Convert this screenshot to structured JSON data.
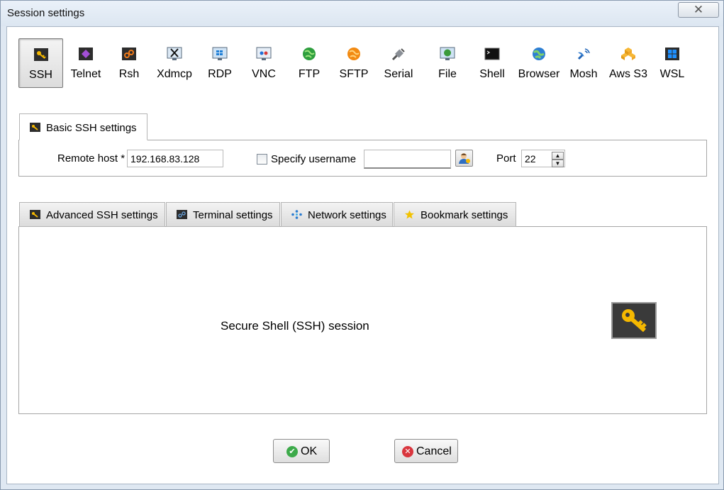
{
  "window": {
    "title": "Session settings",
    "close_glyph": "✕"
  },
  "session_types": [
    {
      "label": "SSH",
      "icon": "ssh-key-icon",
      "active": true
    },
    {
      "label": "Telnet",
      "icon": "telnet-icon"
    },
    {
      "label": "Rsh",
      "icon": "rsh-icon"
    },
    {
      "label": "Xdmcp",
      "icon": "xdmcp-icon"
    },
    {
      "label": "RDP",
      "icon": "rdp-monitor-icon"
    },
    {
      "label": "VNC",
      "icon": "vnc-monitor-icon"
    },
    {
      "label": "FTP",
      "icon": "ftp-globe-icon"
    },
    {
      "label": "SFTP",
      "icon": "sftp-globe-icon"
    },
    {
      "label": "Serial",
      "icon": "serial-plug-icon"
    },
    {
      "label": "File",
      "icon": "file-monitor-icon"
    },
    {
      "label": "Shell",
      "icon": "shell-terminal-icon"
    },
    {
      "label": "Browser",
      "icon": "browser-globe-icon"
    },
    {
      "label": "Mosh",
      "icon": "mosh-satellite-icon"
    },
    {
      "label": "Aws S3",
      "icon": "aws-s3-cubes-icon"
    },
    {
      "label": "WSL",
      "icon": "wsl-windows-icon"
    }
  ],
  "basic_tab": {
    "label": "Basic SSH settings",
    "icon": "ssh-key-icon"
  },
  "basic": {
    "remote_host_label": "Remote host *",
    "remote_host_value": "192.168.83.128",
    "specify_username_label": "Specify username",
    "username_value": "",
    "port_label": "Port",
    "port_value": "22",
    "spin_up": "▲",
    "spin_down": "▼"
  },
  "lower_tabs": [
    {
      "label": "Advanced SSH settings",
      "icon": "ssh-key-icon"
    },
    {
      "label": "Terminal settings",
      "icon": "terminal-icon"
    },
    {
      "label": "Network settings",
      "icon": "network-icon"
    },
    {
      "label": "Bookmark settings",
      "icon": "star-icon"
    }
  ],
  "description": "Secure Shell (SSH) session",
  "buttons": {
    "ok_label": "OK",
    "ok_icon_glyph": "✔",
    "cancel_label": "Cancel",
    "cancel_icon_glyph": "✕"
  },
  "colors": {
    "ok_green": "#3daa4a",
    "cancel_red": "#d9363e",
    "key_yellow": "#f5b800"
  }
}
